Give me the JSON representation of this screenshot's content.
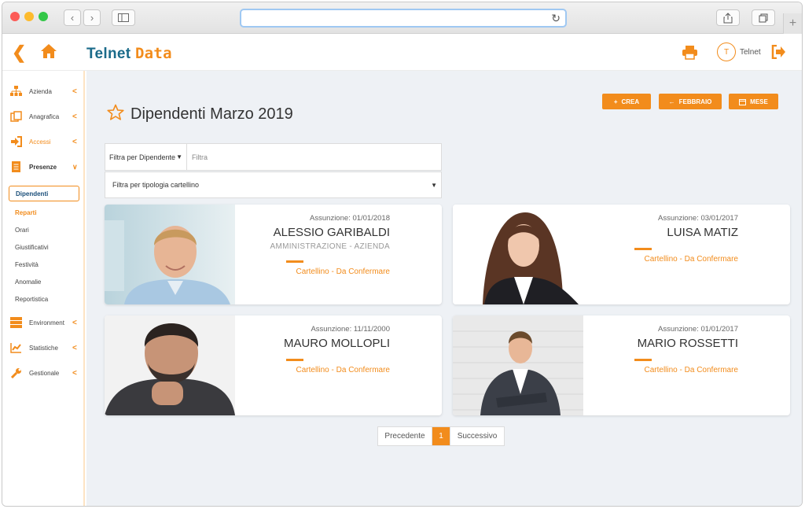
{
  "app": {
    "logo_part1": "Telnet",
    "logo_part2": "Data",
    "user_initial": "T",
    "user_name": "Telnet",
    "accent": "#f28c1c",
    "brand": "#1b6b8a"
  },
  "sidebar": {
    "items": [
      {
        "label": "Azienda",
        "icon": "org-chart-icon"
      },
      {
        "label": "Anagrafica",
        "icon": "id-card-icon"
      },
      {
        "label": "Accessi",
        "icon": "sign-in-icon"
      },
      {
        "label": "Presenze",
        "icon": "clipboard-icon"
      }
    ],
    "submenu": {
      "active": "Dipendenti",
      "items": [
        "Reparti",
        "Orari",
        "Giustificativi",
        "Festività",
        "Anomalie",
        "Reportistica"
      ]
    },
    "bottom_items": [
      {
        "label": "Environment",
        "icon": "server-icon"
      },
      {
        "label": "Statistiche",
        "icon": "line-chart-icon"
      },
      {
        "label": "Gestionale",
        "icon": "wrench-icon"
      }
    ]
  },
  "page": {
    "title": "Dipendenti Marzo 2019",
    "actions": {
      "create": "CREA",
      "prev_month": "FEBBRAIO",
      "month": "MESE"
    },
    "filters": {
      "filter_type": "Filtra per Dipendente",
      "filter_placeholder": "Filtra",
      "card_type": "Filtra per tipologia cartellino"
    }
  },
  "employees": [
    {
      "hire": "Assunzione: 01/01/2018",
      "name": "ALESSIO GARIBALDI",
      "dept": "AMMINISTRAZIONE - AZIENDA",
      "status": "Cartellino - Da Confermare"
    },
    {
      "hire": "Assunzione: 03/01/2017",
      "name": "LUISA MATIZ",
      "dept": "",
      "status": "Cartellino - Da Confermare"
    },
    {
      "hire": "Assunzione: 11/11/2000",
      "name": "MAURO MOLLOPLI",
      "dept": "",
      "status": "Cartellino - Da Confermare"
    },
    {
      "hire": "Assunzione: 01/01/2017",
      "name": "MARIO ROSSETTI",
      "dept": "",
      "status": "Cartellino - Da Confermare"
    }
  ],
  "pagination": {
    "prev": "Precedente",
    "current": "1",
    "next": "Successivo"
  }
}
